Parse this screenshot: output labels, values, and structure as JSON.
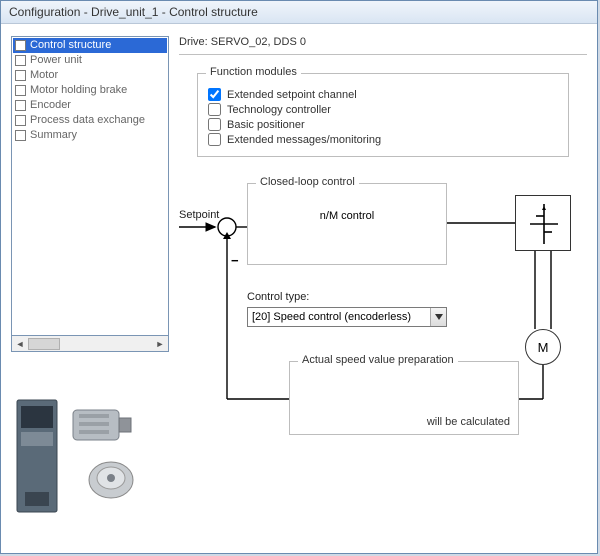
{
  "window": {
    "title": "Configuration - Drive_unit_1 - Control structure"
  },
  "sidebar": {
    "items": [
      {
        "label": "Control structure",
        "selected": true
      },
      {
        "label": "Power unit",
        "selected": false
      },
      {
        "label": "Motor",
        "selected": false
      },
      {
        "label": "Motor holding brake",
        "selected": false
      },
      {
        "label": "Encoder",
        "selected": false
      },
      {
        "label": "Process data exchange",
        "selected": false
      },
      {
        "label": "Summary",
        "selected": false
      }
    ]
  },
  "main": {
    "drive_label": "Drive: SERVO_02, DDS 0",
    "function_modules": {
      "legend": "Function modules",
      "items": [
        {
          "label": "Extended setpoint channel",
          "checked": true
        },
        {
          "label": "Technology controller",
          "checked": false
        },
        {
          "label": "Basic positioner",
          "checked": false
        },
        {
          "label": "Extended messages/monitoring",
          "checked": false
        }
      ]
    },
    "diagram": {
      "setpoint_label": "Setpoint",
      "closed_loop": {
        "legend": "Closed-loop control",
        "text": "n/M control"
      },
      "control_type_label": "Control type:",
      "control_type_value": "[20] Speed control (encoderless)",
      "actual_prep": {
        "legend": "Actual speed value preparation",
        "text": "will be calculated"
      },
      "motor_symbol": "M"
    }
  }
}
